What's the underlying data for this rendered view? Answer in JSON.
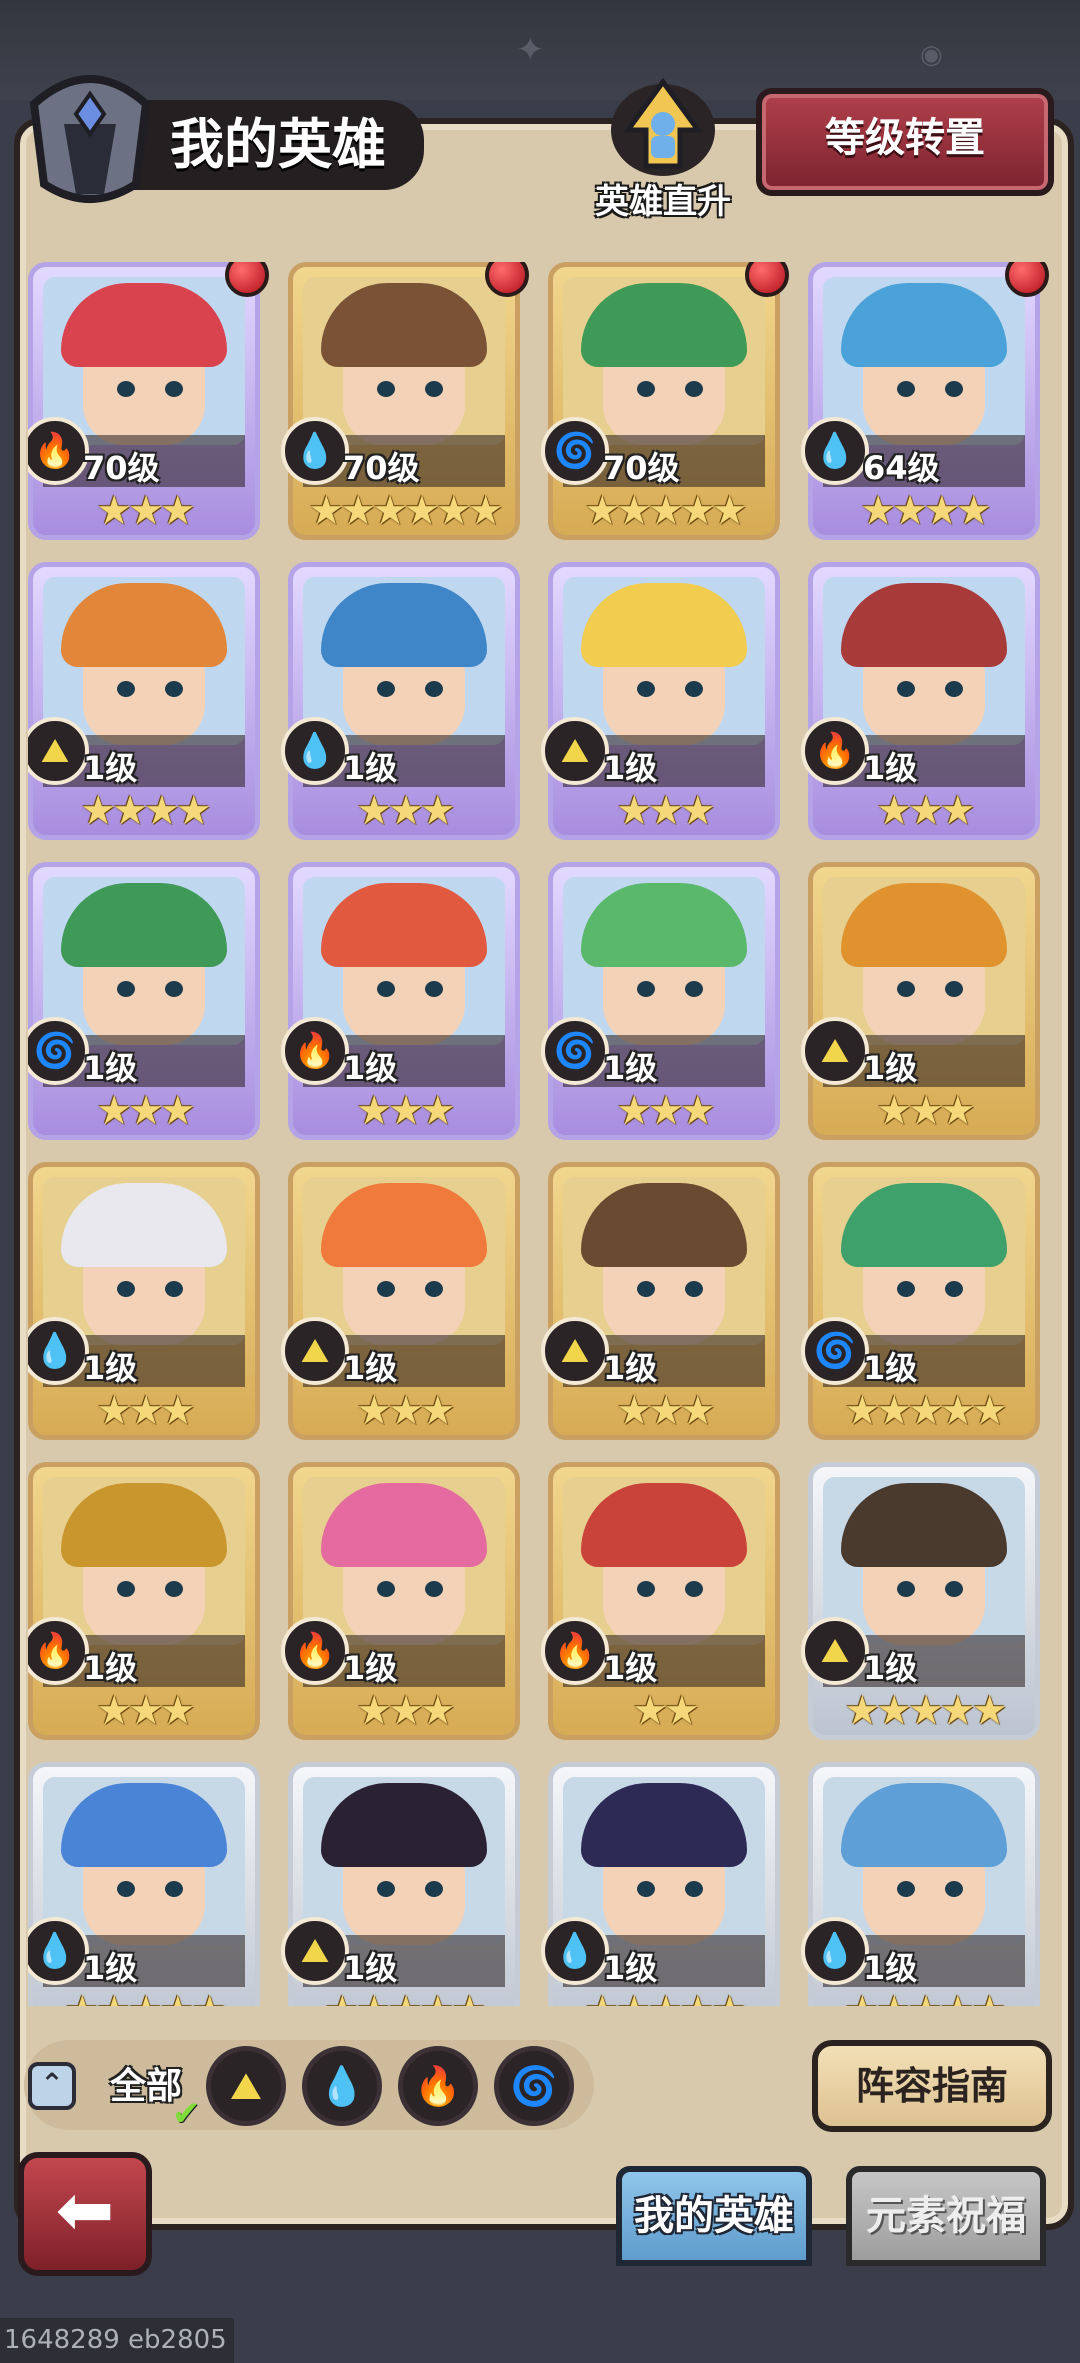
{
  "header": {
    "title": "我的英雄",
    "rise_label": "英雄直升",
    "level_transfer_label": "等级转置"
  },
  "heroes": [
    {
      "level": "70级",
      "stars": "★★★",
      "element": "fire",
      "frame": "purple",
      "notify": true,
      "hair": "#d9434e"
    },
    {
      "level": "70级",
      "stars": "★★★★★★",
      "element": "water",
      "frame": "gold",
      "notify": true,
      "hair": "#7a5236"
    },
    {
      "level": "70级",
      "stars": "★★★★★",
      "element": "wood",
      "frame": "gold",
      "notify": true,
      "hair": "#3f9a58"
    },
    {
      "level": "64级",
      "stars": "★★★★",
      "element": "water",
      "frame": "purple",
      "notify": true,
      "hair": "#4aa2d8"
    },
    {
      "level": "1级",
      "stars": "★★★★",
      "element": "earth",
      "frame": "purple",
      "notify": false,
      "hair": "#e2863a"
    },
    {
      "level": "1级",
      "stars": "★★★",
      "element": "water",
      "frame": "purple",
      "notify": false,
      "hair": "#3e86c7"
    },
    {
      "level": "1级",
      "stars": "★★★",
      "element": "earth",
      "frame": "purple",
      "notify": false,
      "hair": "#f1cc4f"
    },
    {
      "level": "1级",
      "stars": "★★★",
      "element": "fire",
      "frame": "purple",
      "notify": false,
      "hair": "#a83a3a"
    },
    {
      "level": "1级",
      "stars": "★★★",
      "element": "wood",
      "frame": "purple",
      "notify": false,
      "hair": "#3f9a58"
    },
    {
      "level": "1级",
      "stars": "★★★",
      "element": "fire",
      "frame": "purple",
      "notify": false,
      "hair": "#e15a3f"
    },
    {
      "level": "1级",
      "stars": "★★★",
      "element": "wood",
      "frame": "purple",
      "notify": false,
      "hair": "#59b86a"
    },
    {
      "level": "1级",
      "stars": "★★★",
      "element": "earth",
      "frame": "gold",
      "notify": false,
      "hair": "#e0922f"
    },
    {
      "level": "1级",
      "stars": "★★★",
      "element": "water",
      "frame": "gold",
      "notify": false,
      "hair": "#e8e8ee"
    },
    {
      "level": "1级",
      "stars": "★★★",
      "element": "earth",
      "frame": "gold",
      "notify": false,
      "hair": "#ef7a3c"
    },
    {
      "level": "1级",
      "stars": "★★★",
      "element": "earth",
      "frame": "gold",
      "notify": false,
      "hair": "#6a4a30"
    },
    {
      "level": "1级",
      "stars": "★★★★★",
      "element": "wood",
      "frame": "gold",
      "notify": false,
      "hair": "#3ea06a"
    },
    {
      "level": "1级",
      "stars": "★★★",
      "element": "fire",
      "frame": "gold",
      "notify": false,
      "hair": "#c9952d"
    },
    {
      "level": "1级",
      "stars": "★★★",
      "element": "fire",
      "frame": "gold",
      "notify": false,
      "hair": "#e46aa0"
    },
    {
      "level": "1级",
      "stars": "★★",
      "element": "fire",
      "frame": "gold",
      "notify": false,
      "hair": "#c9433a"
    },
    {
      "level": "1级",
      "stars": "★★★★★",
      "element": "earth",
      "frame": "white",
      "notify": false,
      "hair": "#4a3a2e"
    },
    {
      "level": "1级",
      "stars": "★★★★★",
      "element": "water",
      "frame": "white",
      "notify": false,
      "hair": "#4a84d6"
    },
    {
      "level": "1级",
      "stars": "★★★★★",
      "element": "earth",
      "frame": "white",
      "notify": false,
      "hair": "#2a2233"
    },
    {
      "level": "1级",
      "stars": "★★★★★",
      "element": "water",
      "frame": "white",
      "notify": false,
      "hair": "#2d2a55"
    },
    {
      "level": "1级",
      "stars": "★★★★★",
      "element": "water",
      "frame": "white",
      "notify": false,
      "hair": "#5f9fd8"
    }
  ],
  "element_glyphs": {
    "fire": "🔥",
    "water": "💧",
    "wood": "🌀",
    "earth": "⛰"
  },
  "filter": {
    "all_label": "全部",
    "elements": [
      "earth",
      "water",
      "fire",
      "wood"
    ]
  },
  "guide_label": "阵容指南",
  "tabs": {
    "mine": "我的英雄",
    "blessing": "元素祝福"
  },
  "footer_id": "1648289 eb2805"
}
